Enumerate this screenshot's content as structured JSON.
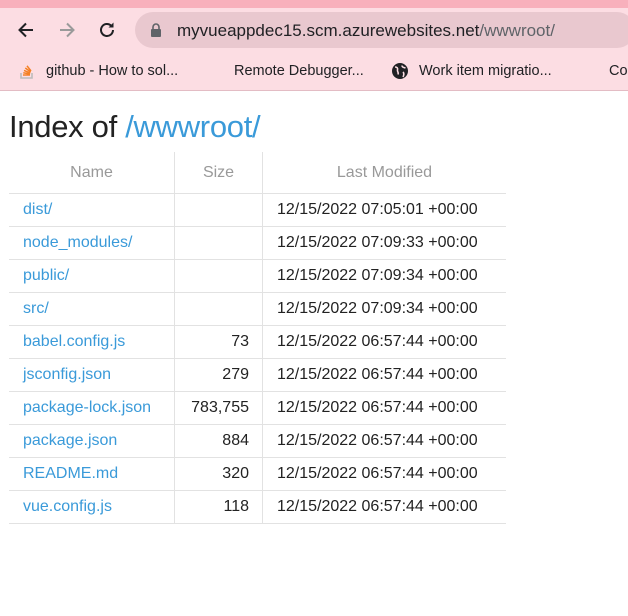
{
  "browser": {
    "url_host": "myvueappdec15.scm.azurewebsites.net",
    "url_path": "/wwwroot/",
    "nav_icons": [
      "back-arrow-icon",
      "forward-arrow-icon",
      "reload-icon"
    ],
    "bookmarks": [
      {
        "label": "github - How to sol...",
        "icon": "stackoverflow-icon"
      },
      {
        "label": "Remote Debugger...",
        "icon": "microsoft-logo-icon"
      },
      {
        "label": "Work item migratio...",
        "icon": "globe-icon"
      },
      {
        "label": "Co",
        "icon": "microsoft-logo-icon"
      }
    ],
    "colors": {
      "toolbar": "#fcdde3",
      "omnibox": "#e9c8cf",
      "strip": "#f8b0bc"
    }
  },
  "page": {
    "title_prefix": "Index of ",
    "title_path": "/wwwroot/",
    "link_color": "#3a9ad9",
    "columns": [
      "Name",
      "Size",
      "Last Modified"
    ],
    "rows": [
      {
        "name": "dist/",
        "size": "",
        "modified": "12/15/2022 07:05:01 +00:00"
      },
      {
        "name": "node_modules/",
        "size": "",
        "modified": "12/15/2022 07:09:33 +00:00"
      },
      {
        "name": "public/",
        "size": "",
        "modified": "12/15/2022 07:09:34 +00:00"
      },
      {
        "name": "src/",
        "size": "",
        "modified": "12/15/2022 07:09:34 +00:00"
      },
      {
        "name": "babel.config.js",
        "size": "73",
        "modified": "12/15/2022 06:57:44 +00:00"
      },
      {
        "name": "jsconfig.json",
        "size": "279",
        "modified": "12/15/2022 06:57:44 +00:00"
      },
      {
        "name": "package-lock.json",
        "size": "783,755",
        "modified": "12/15/2022 06:57:44 +00:00"
      },
      {
        "name": "package.json",
        "size": "884",
        "modified": "12/15/2022 06:57:44 +00:00"
      },
      {
        "name": "README.md",
        "size": "320",
        "modified": "12/15/2022 06:57:44 +00:00"
      },
      {
        "name": "vue.config.js",
        "size": "118",
        "modified": "12/15/2022 06:57:44 +00:00"
      }
    ]
  }
}
